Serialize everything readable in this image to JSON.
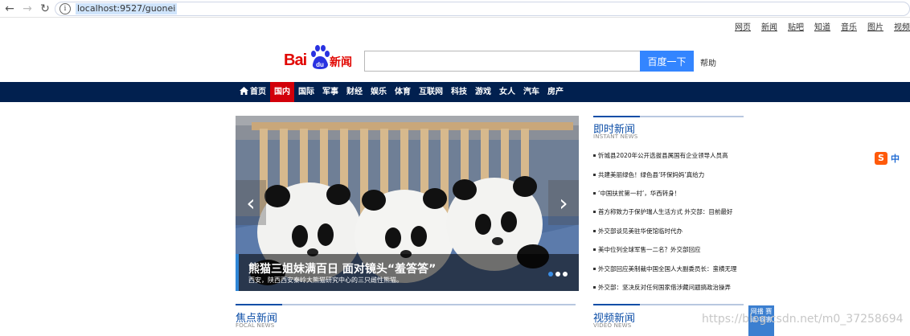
{
  "browser": {
    "back_icon": "arrow-left-icon",
    "forward_icon": "arrow-right-icon",
    "reload_icon": "reload-icon",
    "info_icon": "info-icon",
    "url": "localhost:9527/guonei"
  },
  "top_links": [
    "网页",
    "新闻",
    "贴吧",
    "知道",
    "音乐",
    "图片",
    "视频"
  ],
  "logo": {
    "bai": "Bai",
    "du": "du",
    "news": "新闻"
  },
  "search": {
    "value": "",
    "button_label": "百度一下",
    "help_label": "帮助"
  },
  "nav": {
    "home_label": "首页",
    "items": [
      "国内",
      "国际",
      "军事",
      "财经",
      "娱乐",
      "体育",
      "互联网",
      "科技",
      "游戏",
      "女人",
      "汽车",
      "房产"
    ],
    "active_index": 0
  },
  "slider": {
    "prev_label": "‹",
    "next_label": "›",
    "caption_title": "熊猫三姐妹满百日 面对镜头“羞答答”",
    "caption_sub": "西安，陕西西安秦岭大熊猫研究中心的三只雌性熊猫。",
    "dots_count": 3,
    "active_dot": 0
  },
  "instant_news": {
    "title": "即时新闻",
    "subtitle": "INSTANT NEWS",
    "items": [
      "忻城县2020年公开选拔县属国有企业领导人员高",
      "共建美丽绿色！绿色县‘环保妈妈’真给力",
      "‘中国扶贫第一村’，华西转身！",
      "首方称致力于保护瑞人生活方式 外交部：目前最好",
      "外交部谈见美驻华使馆临时代办",
      "美中位列全球军售一二名？外交部回应",
      "外交部回应美制裁中国全国人大副委员长：蛮横无理",
      "外交部：坚决反对任何国家借涉藏问题搞政治操弄"
    ]
  },
  "focal_news": {
    "title": "焦点新闻",
    "subtitle": "FOCAL NEWS"
  },
  "video_news": {
    "title": "视频新闻",
    "subtitle": "VIDEO NEWS"
  },
  "ime": {
    "icon": "sogou-ime-icon",
    "label": "中"
  },
  "float_box": {
    "label": "网播 赛 话 容害"
  },
  "watermark": "https://blog.csdn.net/m0_37258694",
  "colors": {
    "nav_bg": "#01204f",
    "nav_active": "#d2000a",
    "search_btn": "#3385ff",
    "section_title": "#0d4ea7"
  }
}
